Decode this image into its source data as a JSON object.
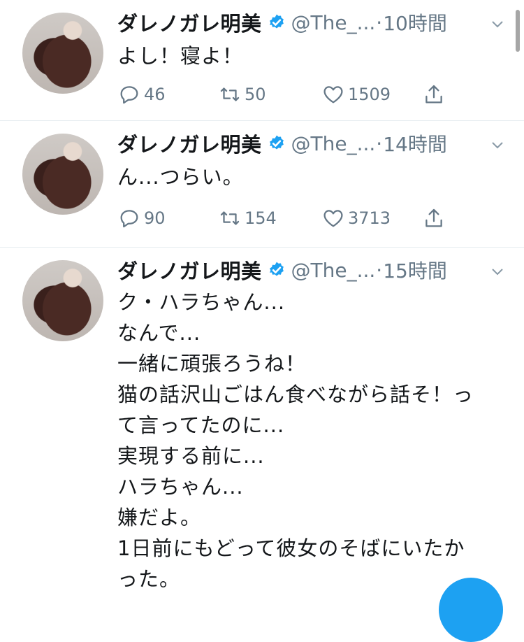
{
  "tweets": [
    {
      "name": "ダレノガレ明美",
      "handle": "@The_...",
      "separator": "·",
      "time": "10時間",
      "lines": [
        "よし！寝よ！"
      ],
      "reply_count": "46",
      "retweet_count": "50",
      "like_count": "1509"
    },
    {
      "name": "ダレノガレ明美",
      "handle": "@The_...",
      "separator": "·",
      "time": "14時間",
      "lines": [
        "ん...つらい。"
      ],
      "reply_count": "90",
      "retweet_count": "154",
      "like_count": "3713"
    },
    {
      "name": "ダレノガレ明美",
      "handle": "@The_...",
      "separator": "·",
      "time": "15時間",
      "lines": [
        "ク・ハラちゃん...",
        "なんで...",
        "一緒に頑張ろうね！",
        "猫の話沢山ごはん食べながら話そ！っ",
        "て言ってたのに...",
        "実現する前に...",
        "ハラちゃん...",
        "嫌だよ。",
        "1日前にもどって彼女のそばにいたか",
        "った。"
      ]
    }
  ],
  "colors": {
    "accent": "#1da1f2",
    "muted": "#657786",
    "divider": "#e6ecf0"
  }
}
